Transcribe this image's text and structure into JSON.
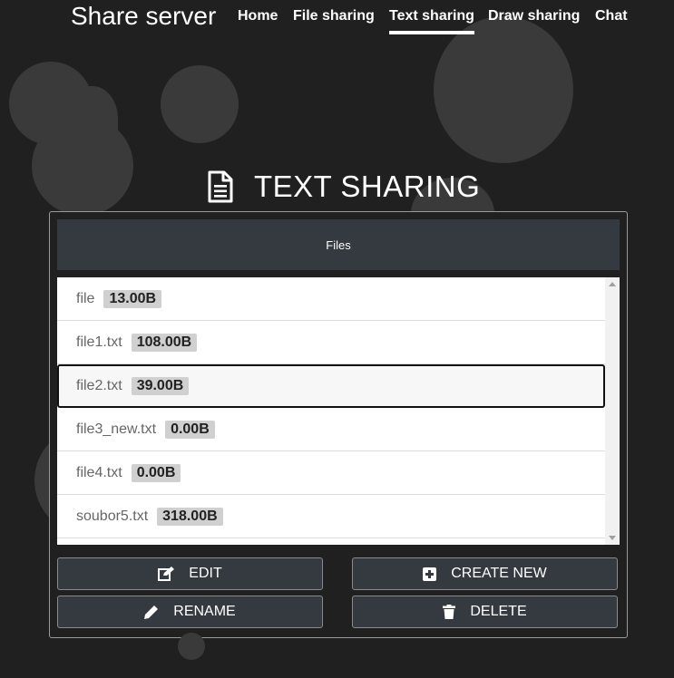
{
  "navbar": {
    "brand": "Share server",
    "links": [
      {
        "label": "Home"
      },
      {
        "label": "File sharing"
      },
      {
        "label": "Text sharing",
        "active": true
      },
      {
        "label": "Draw sharing"
      },
      {
        "label": "Chat"
      }
    ]
  },
  "page": {
    "title": "TEXT SHARING",
    "title_icon": "document-icon"
  },
  "files_panel": {
    "header": "Files",
    "selected_index": 2,
    "files": [
      {
        "name": "file",
        "size": "13.00B"
      },
      {
        "name": "file1.txt",
        "size": "108.00B"
      },
      {
        "name": "file2.txt",
        "size": "39.00B"
      },
      {
        "name": "file3_new.txt",
        "size": "0.00B"
      },
      {
        "name": "file4.txt",
        "size": "0.00B"
      },
      {
        "name": "soubor5.txt",
        "size": "318.00B"
      }
    ]
  },
  "actions": {
    "edit": "EDIT",
    "create_new": "CREATE NEW",
    "rename": "RENAME",
    "delete": "DELETE"
  },
  "colors": {
    "background": "#202020",
    "blob": "#3a3a3a",
    "button": "#343a40",
    "size_badge": "#d0d0d0"
  }
}
